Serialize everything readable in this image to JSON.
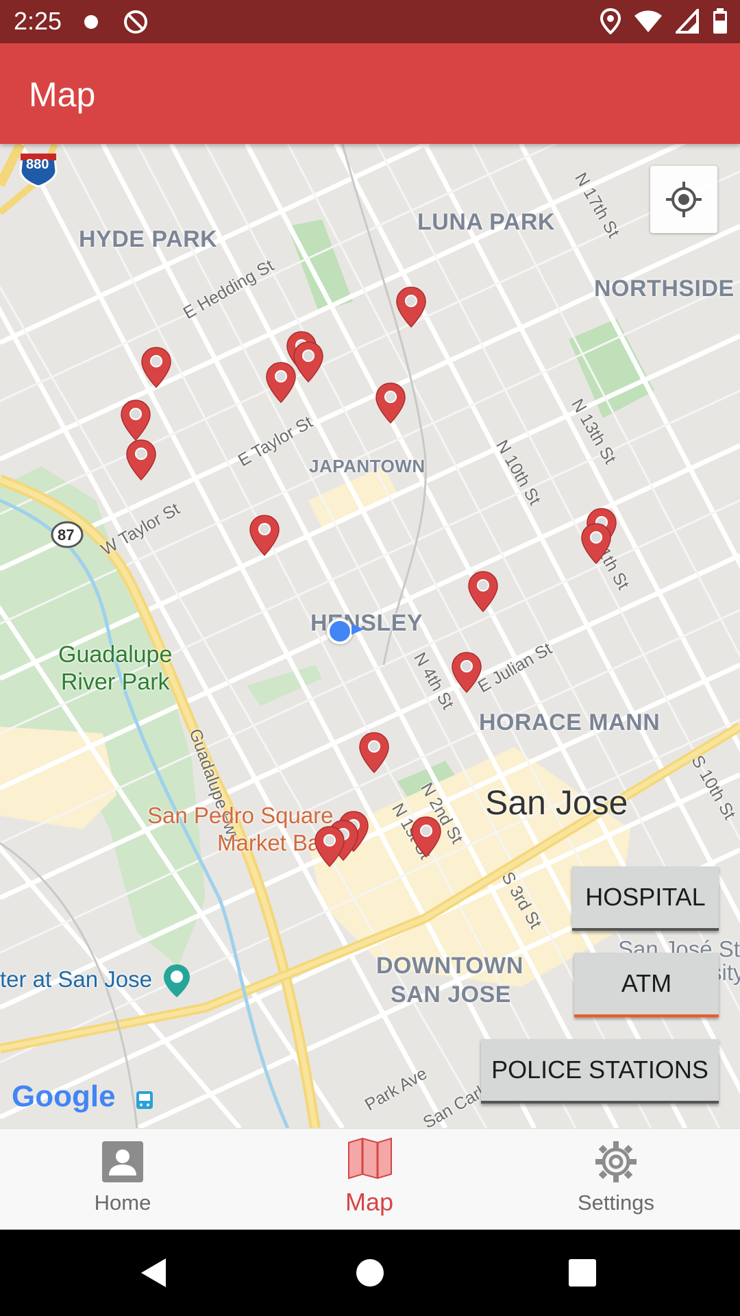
{
  "status_bar": {
    "time": "2:25"
  },
  "app_bar": {
    "title": "Map"
  },
  "map": {
    "neighborhoods": [
      "HYDE PARK",
      "LUNA PARK",
      "NORTHSIDE",
      "JAPANTOWN",
      "HENSLEY",
      "HORACE MANN",
      "DOWNTOWN",
      "SAN JOSE"
    ],
    "streets": [
      "E Hedding St",
      "N 17th St",
      "N 13th St",
      "N 10th St",
      "N 11th St",
      "E Taylor St",
      "W Taylor St",
      "E Julian St",
      "N 4th St",
      "Guadalupe Fwy",
      "N 2nd St",
      "N 1st St",
      "S 3rd St",
      "S 10th St",
      "Park Ave",
      "San Carl"
    ],
    "shields": [
      "880",
      "87"
    ],
    "park": [
      "Guadalupe",
      "River Park"
    ],
    "poi": [
      "San Pedro Square",
      "Market Ba"
    ],
    "city": "San Jose",
    "poi_left": "ter at San Jose",
    "poi_right": [
      "San José St",
      "sity"
    ],
    "attribution": "Google",
    "marker_color": "#d84444",
    "user_location_color": "#4285f4"
  },
  "buttons": {
    "hospital": "HOSPITAL",
    "atm": "ATM",
    "police": "POLICE STATIONS"
  },
  "bottom_nav": {
    "items": [
      {
        "label": "Home",
        "icon": "person-icon"
      },
      {
        "label": "Map",
        "icon": "map-icon",
        "active": true
      },
      {
        "label": "Settings",
        "icon": "gear-icon"
      }
    ],
    "active_color": "#d84444"
  }
}
